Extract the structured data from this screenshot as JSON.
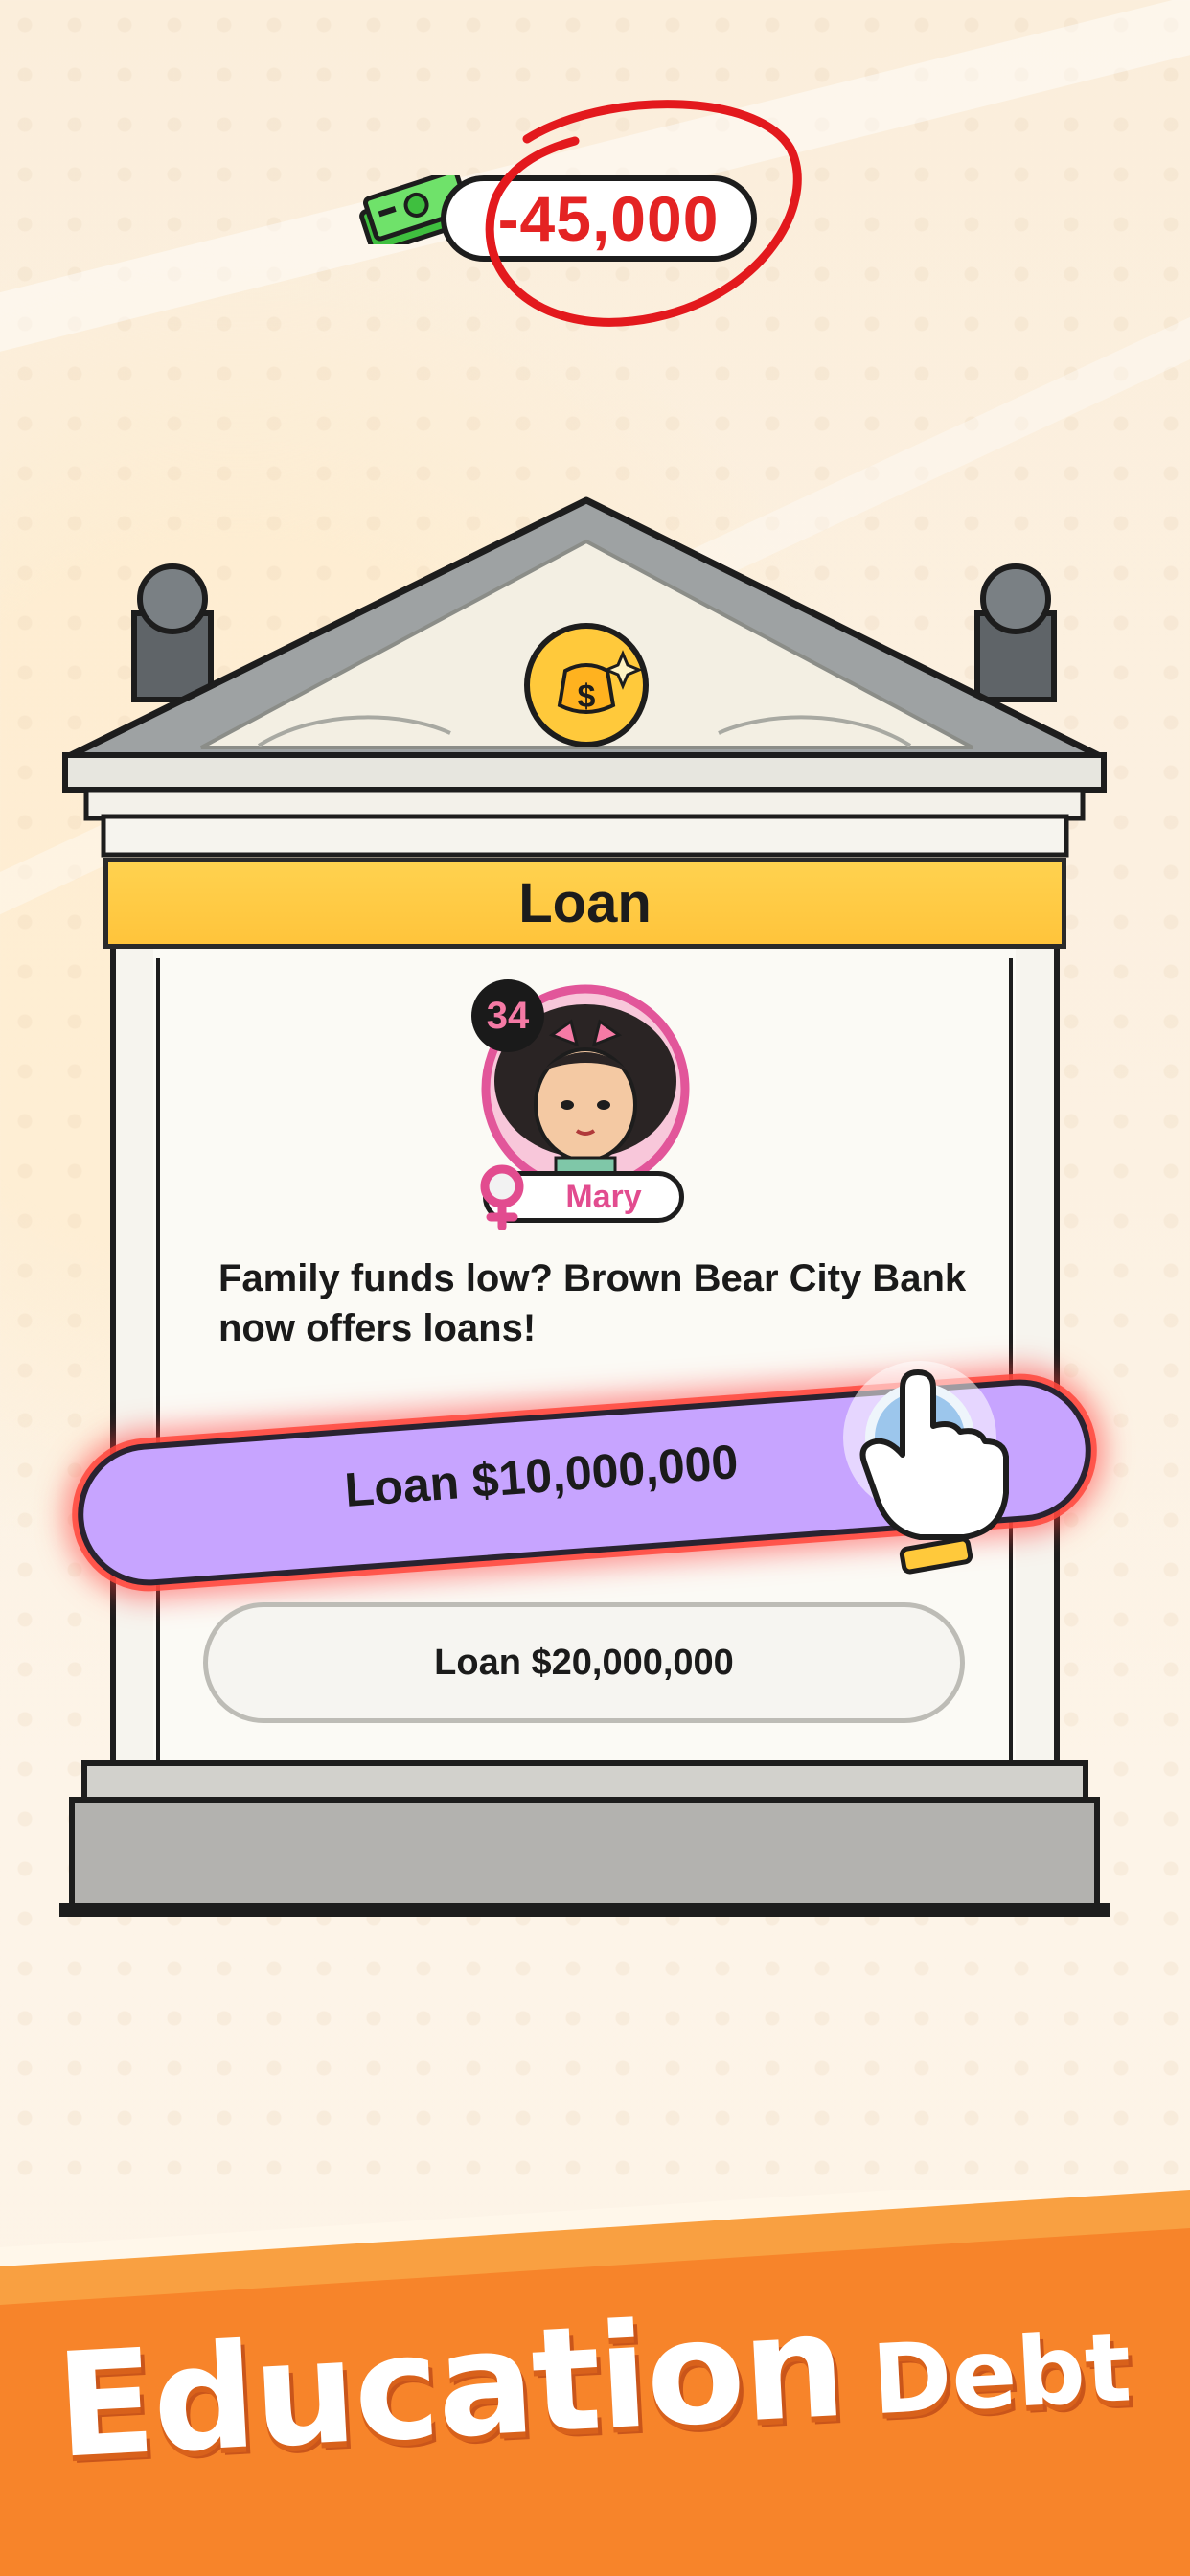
{
  "hud": {
    "money_value": "-45,000",
    "money_icon": "cash-stack-icon",
    "highlight_color": "#e42323"
  },
  "dialog": {
    "title": "Loan",
    "bank_emblem_icon": "money-bag-hand-icon",
    "character": {
      "level": "34",
      "name": "Mary",
      "gender_icon": "female-symbol-icon"
    },
    "message": "Family funds low? Brown Bear City Bank now offers loans!",
    "options": [
      {
        "label": "Loan $10,000,000",
        "highlighted": true,
        "color": "#c7a4ff"
      },
      {
        "label": "Loan $20,000,000",
        "highlighted": false,
        "color": "#f6f5f1"
      }
    ],
    "tap_hint_icon": "pointing-hand-icon"
  },
  "banner": {
    "word1": "Education",
    "word2": "Debt",
    "color": "#f7842a"
  }
}
